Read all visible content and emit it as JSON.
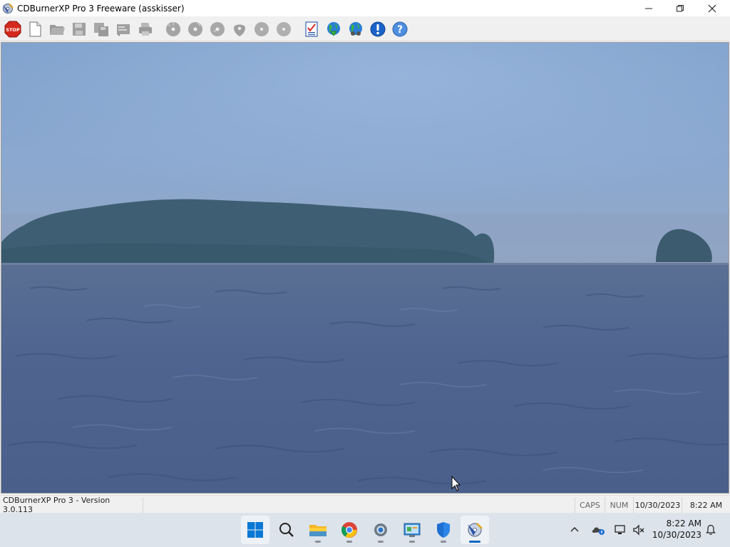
{
  "window": {
    "title": "CDBurnerXP Pro 3 Freeware (asskisser)",
    "controls": [
      "minimize",
      "restore",
      "close"
    ]
  },
  "toolbar": {
    "buttons": [
      {
        "name": "stop-icon",
        "enabled": true
      },
      {
        "name": "new-document-icon",
        "enabled": true
      },
      {
        "name": "open-folder-icon",
        "enabled": false
      },
      {
        "name": "save-icon",
        "enabled": false
      },
      {
        "name": "save-as-icon",
        "enabled": false
      },
      {
        "name": "properties-icon",
        "enabled": false
      },
      {
        "name": "print-icon",
        "enabled": false
      },
      {
        "name": "disc-burn-icon",
        "enabled": false
      },
      {
        "name": "disc-copy-icon",
        "enabled": false
      },
      {
        "name": "disc-erase-icon",
        "enabled": false
      },
      {
        "name": "disc-eject-icon",
        "enabled": false
      },
      {
        "name": "disc-info-icon",
        "enabled": false
      },
      {
        "name": "disc-verify-icon",
        "enabled": false
      },
      {
        "name": "checklist-icon",
        "enabled": true
      },
      {
        "name": "web-update-icon",
        "enabled": true
      },
      {
        "name": "web-community-icon",
        "enabled": true
      },
      {
        "name": "info-icon",
        "enabled": true
      },
      {
        "name": "help-icon",
        "enabled": true
      }
    ]
  },
  "statusbar": {
    "version": "CDBurnerXP Pro 3 - Version 3.0.113",
    "caps": "CAPS",
    "num": "NUM",
    "date": "10/30/2023",
    "time": "8:22 AM"
  },
  "taskbar": {
    "apps": [
      "start-icon",
      "search-icon",
      "file-explorer-icon",
      "chrome-icon",
      "settings-icon",
      "control-panel-icon",
      "defender-icon",
      "cdburnerxp-icon"
    ],
    "clock_time": "8:22 AM",
    "clock_date": "10/30/2023"
  },
  "colors": {
    "accent": "#0067c0",
    "taskbar": "#dde3ea"
  }
}
